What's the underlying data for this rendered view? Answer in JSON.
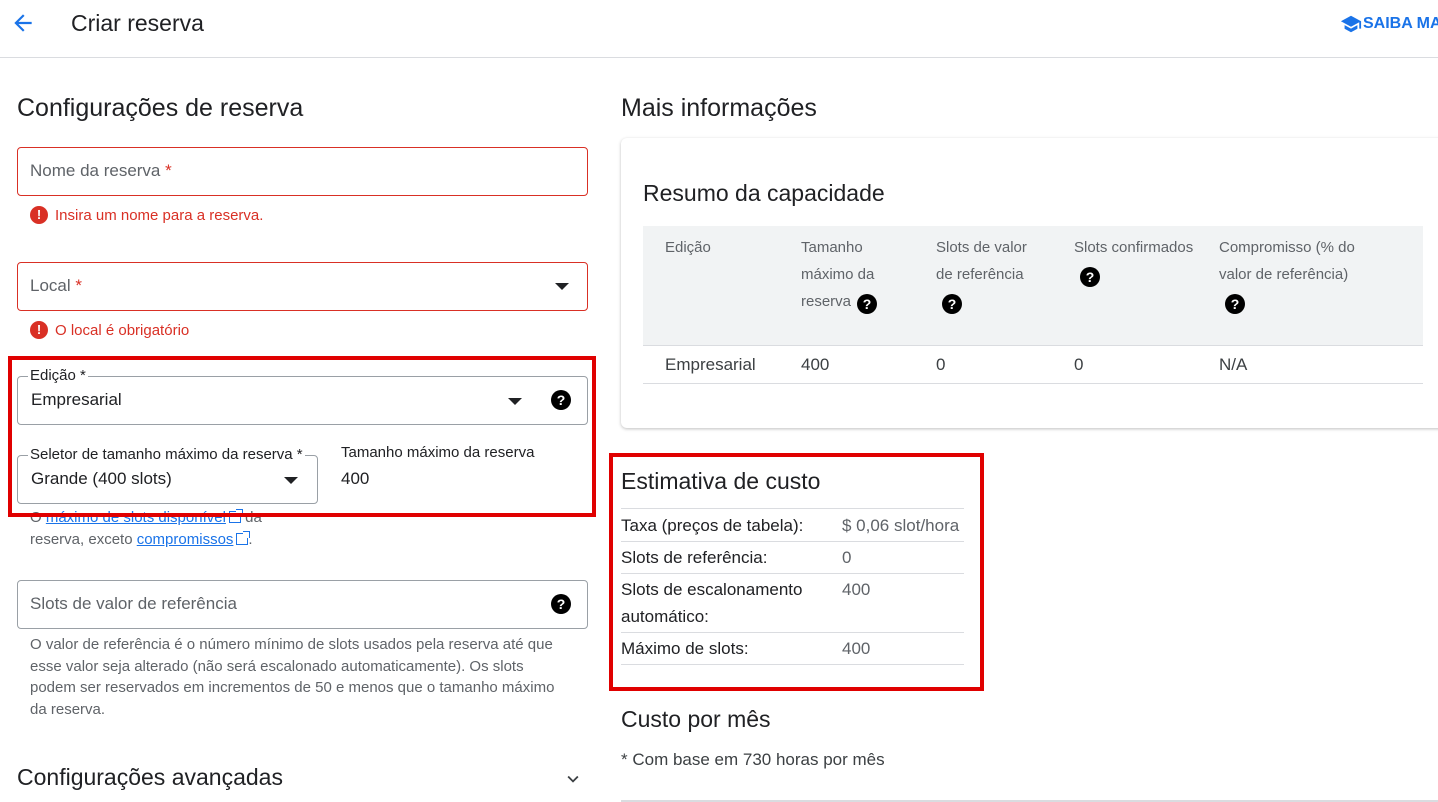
{
  "header": {
    "title": "Criar reserva",
    "learn_more": "SAIBA MA"
  },
  "left": {
    "section_title": "Configurações de reserva",
    "reservation_name": {
      "placeholder": "Nome da reserva",
      "required_mark": "*",
      "error": "Insira um nome para a reserva."
    },
    "location": {
      "placeholder": "Local",
      "required_mark": "*",
      "error": "O local é obrigatório"
    },
    "edition": {
      "label": "Edição *",
      "value": "Empresarial"
    },
    "max_size_selector": {
      "label": "Seletor de tamanho máximo da reserva *",
      "value": "Grande (400 slots)"
    },
    "max_size": {
      "label": "Tamanho máximo da reserva",
      "value": "400"
    },
    "max_hint": {
      "prefix": "O",
      "link1": "máximo de slots disponível",
      "middle1": "da",
      "middle2": "reserva, exceto",
      "link2": "compromissos",
      "suffix": "."
    },
    "baseline": {
      "placeholder": "Slots de valor de referência",
      "hint": "O valor de referência é o número mínimo de slots usados pela reserva até que esse valor seja alterado (não será escalonado automaticamente). Os slots podem ser reservados em incrementos de 50 e menos que o tamanho máximo da reserva."
    },
    "advanced_title": "Configurações avançadas"
  },
  "right": {
    "section_title": "Mais informações",
    "capacity": {
      "title": "Resumo da capacidade",
      "headers": [
        "Edição",
        "Tamanho máximo da reserva",
        "Slots de valor de referência",
        "Slots confirmados",
        "Compromisso (% do valor de referência)"
      ],
      "row": [
        "Empresarial",
        "400",
        "0",
        "0",
        "N/A"
      ]
    },
    "estimate": {
      "title": "Estimativa de custo",
      "rows": [
        {
          "label": "Taxa (preços de tabela):",
          "value": "$ 0,06 slot/hora"
        },
        {
          "label": "Slots de referência:",
          "value": "0"
        },
        {
          "label": "Slots de escalonamento automático:",
          "value": "400"
        },
        {
          "label": "Máximo de slots:",
          "value": "400"
        }
      ]
    },
    "monthly": {
      "title": "Custo por mês",
      "note": "* Com base em 730 horas por mês"
    }
  },
  "colors": {
    "accent": "#1a73e8",
    "error": "#d93025",
    "highlight": "#e00000"
  }
}
